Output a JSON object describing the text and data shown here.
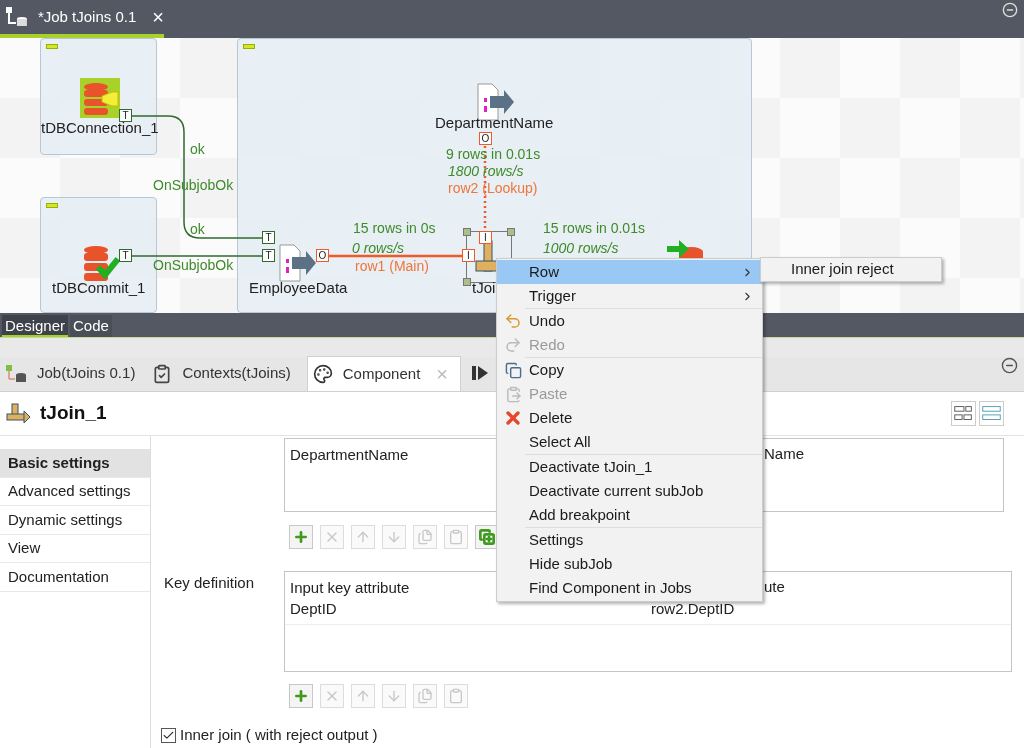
{
  "editor_tab": {
    "title": "*Job tJoins 0.1",
    "close": "×",
    "selected": true
  },
  "canvas": {
    "nodes": [
      {
        "label": "tDBConnection_1",
        "kind": "connection",
        "selected": false
      },
      {
        "label": "DepartmentName",
        "kind": "file",
        "selected": false
      },
      {
        "label": "tDBCommit_1",
        "kind": "commit",
        "selected": false
      },
      {
        "label": "EmployeeData",
        "kind": "file",
        "selected": false
      },
      {
        "label": "tJoi",
        "kind": "join",
        "selected": true
      },
      {
        "kind": "output",
        "selected": false
      }
    ],
    "labels": [
      {
        "text": "ok",
        "kind": "trigger"
      },
      {
        "text": "OnSubjobOk",
        "kind": "trigger"
      },
      {
        "text": "ok",
        "kind": "trigger"
      },
      {
        "text": "OnSubjobOk",
        "kind": "trigger"
      },
      {
        "text": "9 rows in 0.01s",
        "kind": "count"
      },
      {
        "text": "1800 rows/s",
        "kind": "rate"
      },
      {
        "text": "row2 (Lookup)",
        "kind": "flow"
      },
      {
        "text": "15 rows in 0s",
        "kind": "count"
      },
      {
        "text": "0 rows/s",
        "kind": "rate"
      },
      {
        "text": "row1 (Main)",
        "kind": "flow"
      },
      {
        "text": "15 rows in 0.01s",
        "kind": "count"
      },
      {
        "text": "1000 rows/s",
        "kind": "rate"
      }
    ],
    "ports": [
      {
        "text": "T",
        "kind": "trigger"
      },
      {
        "text": "T",
        "kind": "trigger"
      },
      {
        "text": "T",
        "kind": "trigger"
      },
      {
        "text": "T",
        "kind": "trigger"
      },
      {
        "text": "O",
        "kind": "flow"
      },
      {
        "text": "O",
        "kind": "flow"
      },
      {
        "text": "I",
        "kind": "flow"
      },
      {
        "text": "I",
        "kind": "flow"
      }
    ]
  },
  "view_tabs": [
    {
      "label": "Designer",
      "selected": true
    },
    {
      "label": "Code",
      "selected": false
    }
  ],
  "panel_tabs": [
    {
      "label": "Job(tJoins 0.1)",
      "kind": "job",
      "selected": false
    },
    {
      "label": "Contexts(tJoins)",
      "kind": "contexts",
      "selected": false
    },
    {
      "label": "Component",
      "kind": "component",
      "selected": true,
      "close": "×"
    }
  ],
  "component": {
    "title": "tJoin_1"
  },
  "settings_nav": [
    {
      "label": "Basic settings",
      "selected": true
    },
    {
      "label": "Advanced settings",
      "selected": false
    },
    {
      "label": "Dynamic settings",
      "selected": false
    },
    {
      "label": "View",
      "selected": false
    },
    {
      "label": "Documentation",
      "selected": false
    }
  ],
  "output_table": {
    "columns": [
      "DepartmentName",
      "Name"
    ],
    "toolbar": [
      {
        "kind": "add",
        "disabled": false
      },
      {
        "kind": "remove",
        "disabled": true
      },
      {
        "kind": "up",
        "disabled": true
      },
      {
        "kind": "down",
        "disabled": true
      },
      {
        "kind": "copy",
        "disabled": true
      },
      {
        "kind": "paste",
        "disabled": true
      },
      {
        "kind": "add_all",
        "disabled": false
      }
    ]
  },
  "key_definition": {
    "label": "Key definition",
    "columns": [
      "Input key attribute",
      "ute"
    ],
    "rows": [
      [
        "DeptID",
        "row2.DeptID"
      ]
    ],
    "toolbar": [
      {
        "kind": "add",
        "disabled": false
      },
      {
        "kind": "remove",
        "disabled": true
      },
      {
        "kind": "up",
        "disabled": true
      },
      {
        "kind": "down",
        "disabled": true
      },
      {
        "kind": "copy",
        "disabled": true
      },
      {
        "kind": "paste",
        "disabled": true
      }
    ]
  },
  "inner_join": {
    "label": "Inner join ( with reject output )",
    "checked": true
  },
  "context_menu": {
    "groups": [
      [
        {
          "label": "Row",
          "kind": "plain",
          "submenu": true,
          "selected": true,
          "disabled": false
        },
        {
          "label": "Trigger",
          "kind": "plain",
          "submenu": true,
          "selected": false,
          "disabled": false
        }
      ],
      [
        {
          "label": "Undo",
          "kind": "undo",
          "submenu": false,
          "selected": false,
          "disabled": false
        },
        {
          "label": "Redo",
          "kind": "redo",
          "submenu": false,
          "selected": false,
          "disabled": true
        }
      ],
      [
        {
          "label": "Copy",
          "kind": "copy",
          "submenu": false,
          "selected": false,
          "disabled": false
        },
        {
          "label": "Paste",
          "kind": "paste",
          "submenu": false,
          "selected": false,
          "disabled": true
        },
        {
          "label": "Delete",
          "kind": "delete",
          "submenu": false,
          "selected": false,
          "disabled": false
        },
        {
          "label": "Select All",
          "kind": "plain",
          "submenu": false,
          "selected": false,
          "disabled": false
        }
      ],
      [
        {
          "label": "Deactivate tJoin_1",
          "kind": "plain",
          "submenu": false,
          "selected": false,
          "disabled": false
        },
        {
          "label": "Deactivate current subJob",
          "kind": "plain",
          "submenu": false,
          "selected": false,
          "disabled": false
        },
        {
          "label": "Add breakpoint",
          "kind": "plain",
          "submenu": false,
          "selected": false,
          "disabled": false
        }
      ],
      [
        {
          "label": "Settings",
          "kind": "plain",
          "submenu": false,
          "selected": false,
          "disabled": false
        },
        {
          "label": "Hide subJob",
          "kind": "plain",
          "submenu": false,
          "selected": false,
          "disabled": false
        },
        {
          "label": "Find Component in Jobs",
          "kind": "plain",
          "submenu": false,
          "selected": false,
          "disabled": false
        }
      ]
    ]
  },
  "submenu": {
    "items": [
      {
        "label": "Inner join reject"
      }
    ]
  }
}
